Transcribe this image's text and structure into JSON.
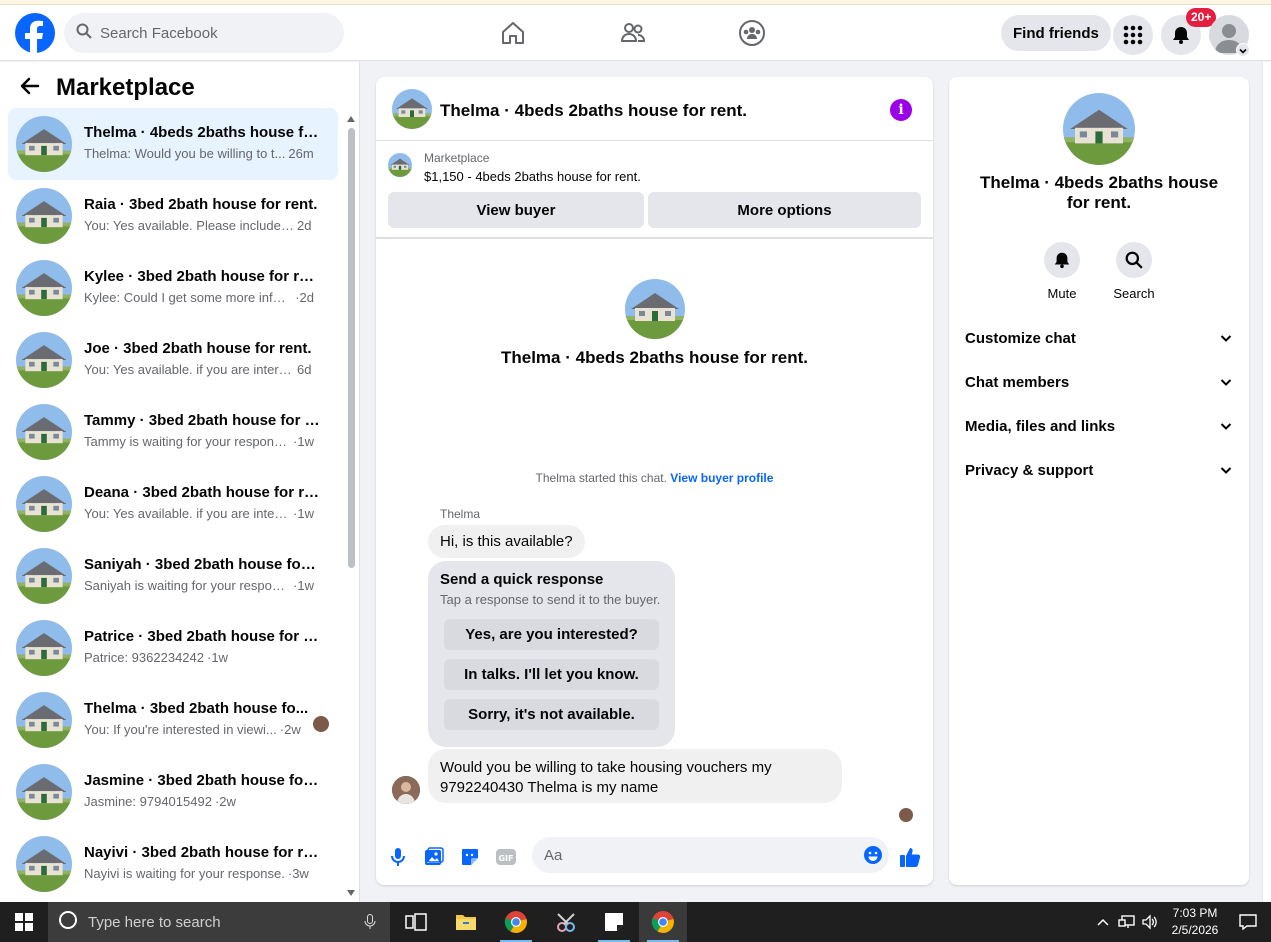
{
  "browser": {
    "search_placeholder": "Search Facebook"
  },
  "topnav": {
    "find_friends": "Find friends",
    "notification_count": "20+"
  },
  "sidebar": {
    "title": "Marketplace",
    "conversations": [
      {
        "title": "Thelma · 4beds 2baths house fo...",
        "preview": "Thelma: Would you be willing to t...",
        "time": "26m",
        "active": true
      },
      {
        "title": "Raia · 3bed 2bath house for rent.",
        "preview": "You: Yes available. Please include y...",
        "time": "2d"
      },
      {
        "title": "Kylee · 3bed 2bath house for rent.",
        "preview": "Kylee: Could I get some more infor...",
        "time": "·2d"
      },
      {
        "title": "Joe · 3bed 2bath house for rent.",
        "preview": "You: Yes available. if you are interes...",
        "time": "6d"
      },
      {
        "title": "Tammy · 3bed 2bath house for r...",
        "preview": "Tammy is waiting for your response.",
        "time": "·1w"
      },
      {
        "title": "Deana · 3bed 2bath house for re...",
        "preview": "You: Yes available. if you are interes...",
        "time": "·1w"
      },
      {
        "title": "Saniyah · 3bed 2bath house for r...",
        "preview": "Saniyah is waiting for your response.",
        "time": "·1w"
      },
      {
        "title": "Patrice · 3bed 2bath house for r...",
        "preview": "Patrice: 9362234242",
        "time": "·1w"
      },
      {
        "title": "Thelma · 3bed 2bath house fo...",
        "preview": "You: If you're interested in viewi...",
        "time": "·2w"
      },
      {
        "title": "Jasmine · 3bed 2bath house for ...",
        "preview": "Jasmine: 9794015492",
        "time": "·2w"
      },
      {
        "title": "Nayivi · 3bed 2bath house for re...",
        "preview": "Nayivi is waiting for your response.",
        "time": "·3w"
      }
    ]
  },
  "chat": {
    "header_title": "Thelma · 4beds 2baths house for rent.",
    "listing_category": "Marketplace",
    "listing_price": "$1,150 - 4beds 2baths house for rent.",
    "view_buyer": "View buyer",
    "more_options": "More options",
    "intro_title": "Thelma · 4beds 2baths house for rent.",
    "started_text": "Thelma started this chat.",
    "view_profile": "View buyer profile",
    "sender_name": "Thelma",
    "first_message": "Hi, is this available?",
    "quick_title": "Send a quick response",
    "quick_subtitle": "Tap a response to send it to the buyer.",
    "quick_responses": [
      "Yes, are you interested?",
      "In talks. I'll let you know.",
      "Sorry, it's not available."
    ],
    "last_message_line1": "Would you be willing to take housing vouchers my",
    "last_message_line2": "9792240430 Thelma is my name",
    "composer_placeholder": "Aa"
  },
  "details": {
    "title": "Thelma · 4beds 2baths house for rent.",
    "mute": "Mute",
    "search": "Search",
    "sections": [
      "Customize chat",
      "Chat members",
      "Media, files and links",
      "Privacy & support"
    ]
  },
  "taskbar": {
    "search_placeholder": "Type here to search",
    "time": "7:03 PM",
    "date": "2/5/2026"
  },
  "colors": {
    "brand": "#0866ff",
    "info": "#9b00e6",
    "badge": "#e41e3f"
  }
}
